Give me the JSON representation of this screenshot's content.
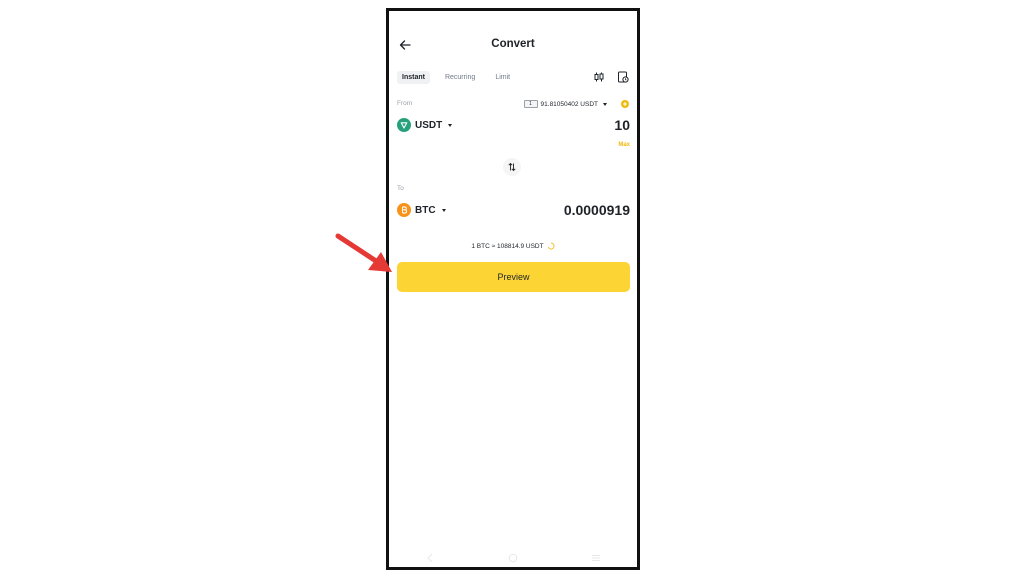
{
  "header": {
    "title": "Convert",
    "back_icon": "arrow-left-icon"
  },
  "tabs": [
    {
      "label": "Instant",
      "active": true
    },
    {
      "label": "Recurring",
      "active": false
    },
    {
      "label": "Limit",
      "active": false
    }
  ],
  "toolbar": {
    "icons": [
      "candlestick-chart-icon",
      "order-history-icon"
    ]
  },
  "from": {
    "label": "From",
    "wallet_badge": "1",
    "balance": "91.81050402 USDT",
    "coin": "USDT",
    "coin_color": "#26a17b",
    "amount": "10",
    "max_label": "Max"
  },
  "to": {
    "label": "To",
    "coin": "BTC",
    "coin_color": "#f7931a",
    "amount": "0.0000919"
  },
  "rate": {
    "text": "1 BTC ≈ 108814.9 USDT"
  },
  "actions": {
    "preview_label": "Preview"
  },
  "colors": {
    "accent": "#fcd535",
    "max_link": "#f0b90b",
    "annotation_arrow": "#e53935"
  }
}
